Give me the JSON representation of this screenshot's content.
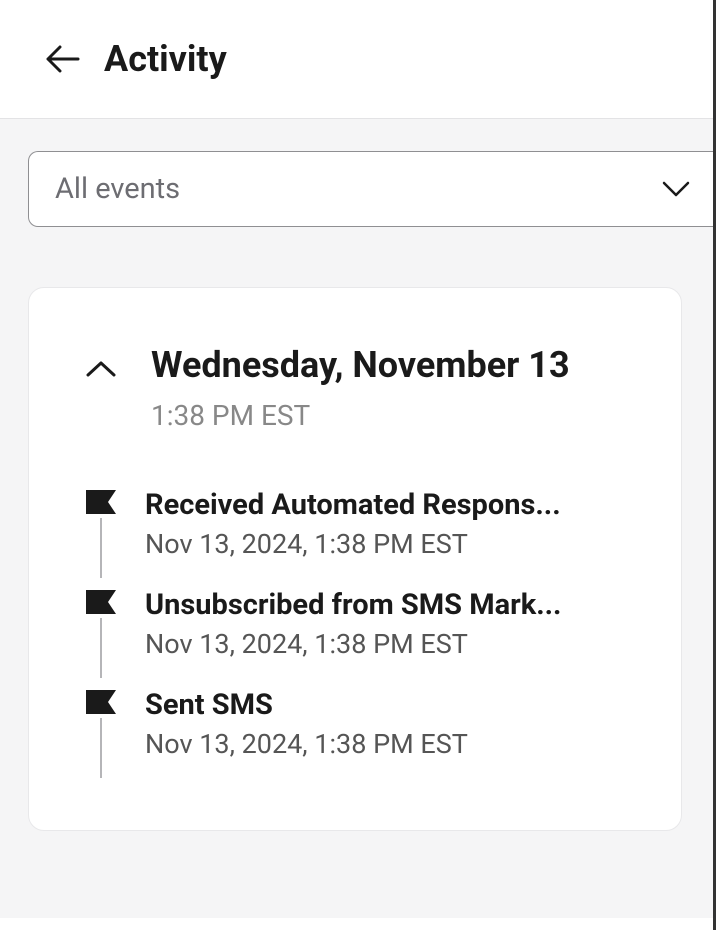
{
  "header": {
    "title": "Activity"
  },
  "filter": {
    "selected": "All events"
  },
  "dateGroup": {
    "date": "Wednesday, November 13",
    "time": "1:38 PM EST"
  },
  "events": [
    {
      "title": "Received Automated Respons...",
      "timestamp": "Nov 13, 2024, 1:38 PM EST"
    },
    {
      "title": "Unsubscribed from SMS Mark...",
      "timestamp": "Nov 13, 2024, 1:38 PM EST"
    },
    {
      "title": "Sent SMS",
      "timestamp": "Nov 13, 2024, 1:38 PM EST"
    }
  ]
}
